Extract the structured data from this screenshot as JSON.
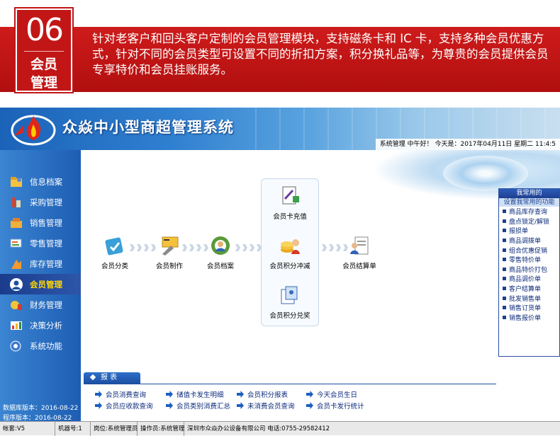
{
  "banner": {
    "number": "06",
    "title_line1": "会员",
    "title_line2": "管理",
    "description": "针对老客户和回头客户定制的会员管理模块，支持磁条卡和 IC 卡，支持多种会员优惠方式，针对不同的会员类型可设置不同的折扣方案，积分换礼品等，为尊贵的会员提供会员专享特价和会员挂账服务。"
  },
  "app": {
    "title": "众焱中小型商超管理系统",
    "status_text": "系统管理 中午好！ 今天是：2017年04月11日 星期二 11:4:5"
  },
  "sidebar": {
    "items": [
      {
        "label": "信息档案",
        "icon": "archive-icon"
      },
      {
        "label": "采购管理",
        "icon": "purchase-icon"
      },
      {
        "label": "销售管理",
        "icon": "sales-icon"
      },
      {
        "label": "零售管理",
        "icon": "retail-icon"
      },
      {
        "label": "库存管理",
        "icon": "inventory-icon"
      },
      {
        "label": "会员管理",
        "icon": "member-icon"
      },
      {
        "label": "财务管理",
        "icon": "finance-icon"
      },
      {
        "label": "决策分析",
        "icon": "analysis-icon"
      },
      {
        "label": "系统功能",
        "icon": "system-icon"
      }
    ],
    "active_index": 5,
    "db_version": "数据库版本：2016-08-22",
    "app_version": "程序版本：2016-08-22"
  },
  "flow": {
    "member_category": "会员分类",
    "member_card_make": "会员制作",
    "member_archive": "会员档案",
    "card_recharge": "会员卡充值",
    "points_offset": "会员积分冲减",
    "points_redeem": "会员积分兑奖",
    "member_checkout": "会员结算单"
  },
  "quick": {
    "header": "我常用的",
    "setup": "设置我常用的功能",
    "items": [
      "商品库存查询",
      "盘点锁定/解锁",
      "报损单",
      "商品调拨单",
      "组合优惠促销",
      "零售特价单",
      "商品特价打包",
      "商品调价单",
      "客户结算单",
      "批发销售单",
      "销售订货单",
      "销售报价单"
    ]
  },
  "report": {
    "tab": "报 表",
    "links": [
      "会员消费查询",
      "储值卡发生明细",
      "会员积分报表",
      "今天会员生日",
      "会员应收款查询",
      "会员类别消费汇总",
      "未消费会员查询",
      "会员卡发行统计"
    ]
  },
  "statusbar": {
    "account": "帐套:V5",
    "machine": "机器号:1",
    "post": "岗位:系统管理员",
    "operator": "操作员:系统管理",
    "company": "深圳市众焱办公设备有限公司 电话:0755-29582412"
  },
  "colors": {
    "banner_red": "#c21616",
    "header_blue": "#1b63b8",
    "active_text": "#ffd800"
  }
}
